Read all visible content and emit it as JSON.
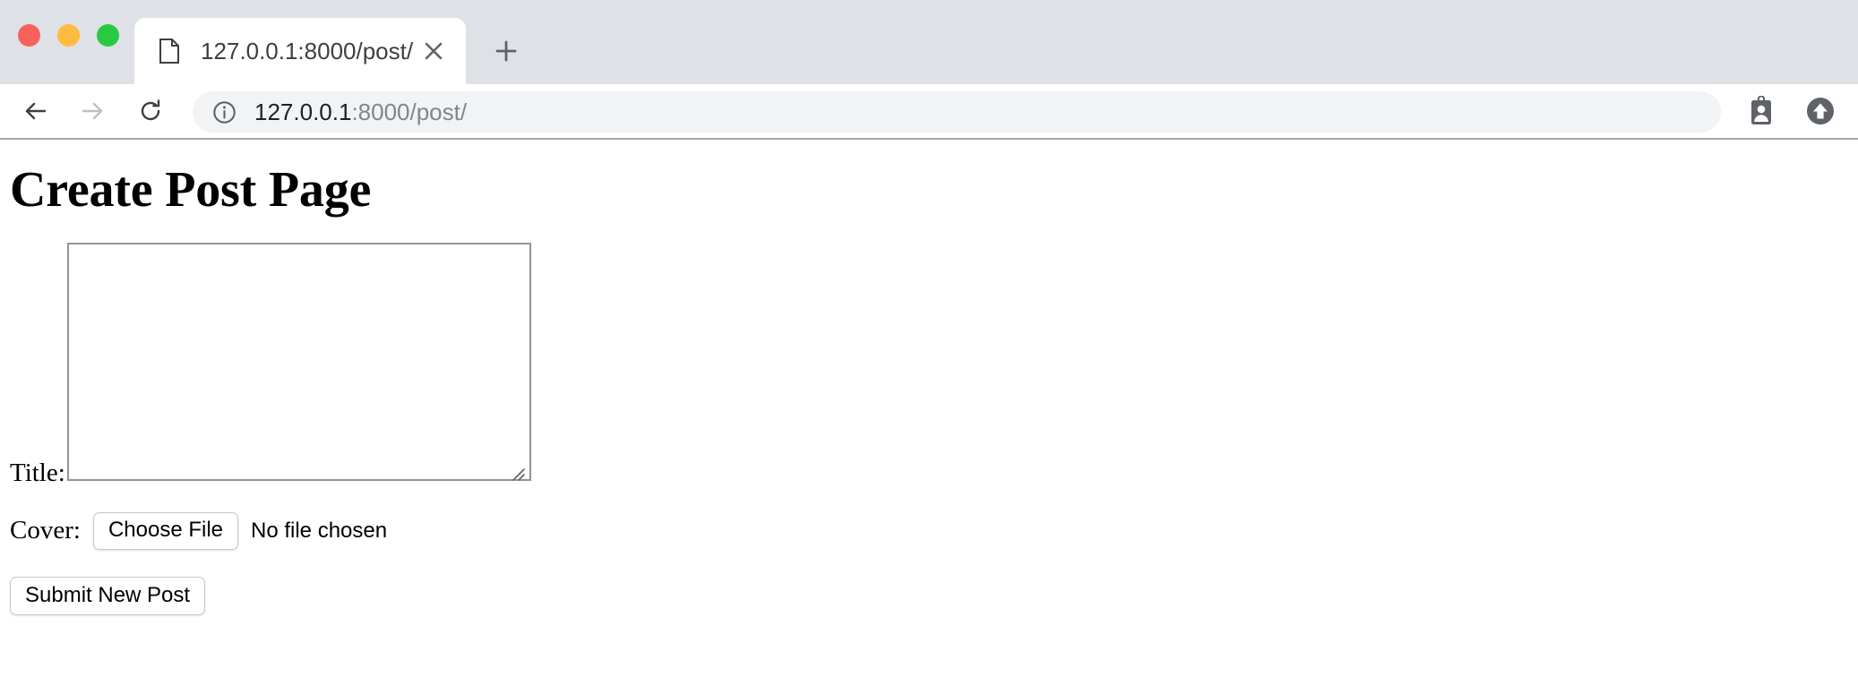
{
  "browser": {
    "traffic_lights": [
      {
        "name": "close",
        "color": "#f9625c"
      },
      {
        "name": "minimize",
        "color": "#fdbc40"
      },
      {
        "name": "zoom",
        "color": "#29ca41"
      }
    ],
    "tab": {
      "title": "127.0.0.1:8000/post/",
      "favicon": "document-icon",
      "close_label": "×"
    },
    "new_tab_label": "+",
    "nav": {
      "back": "back-arrow-icon",
      "forward": "forward-arrow-icon",
      "reload": "reload-icon"
    },
    "omnibox": {
      "site_info_icon": "info-circle-icon",
      "url_host": "127.0.0.1",
      "url_rest": ":8000/post/",
      "full_url": "127.0.0.1:8000/post/"
    },
    "actions": [
      {
        "name": "profile-badge-icon"
      },
      {
        "name": "update-upload-icon"
      }
    ]
  },
  "page": {
    "title": "Create Post Page",
    "fields": {
      "title_label": "Title:",
      "title_value": "",
      "cover_label": "Cover:",
      "choose_file_label": "Choose File",
      "file_status": "No file chosen"
    },
    "submit_label": "Submit New Post"
  }
}
